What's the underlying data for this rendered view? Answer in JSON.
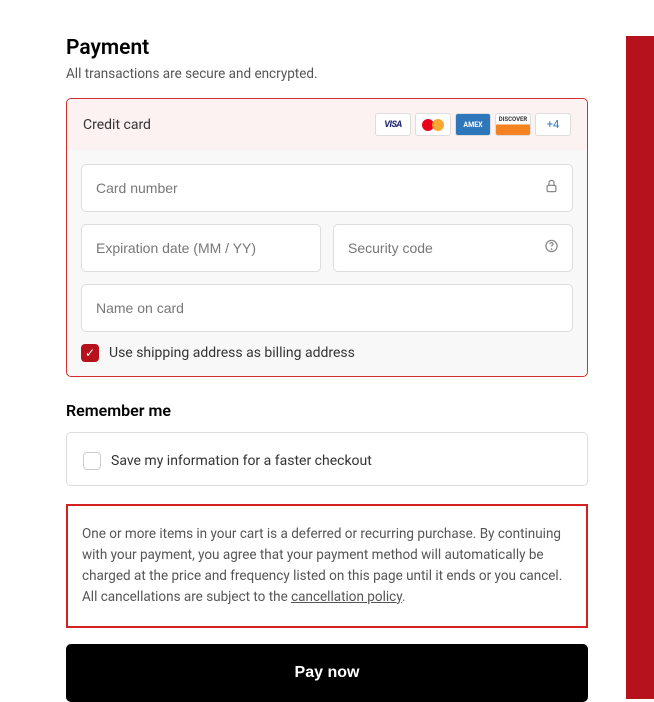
{
  "payment": {
    "title": "Payment",
    "subtitle": "All transactions are secure and encrypted.",
    "method_label": "Credit card",
    "cards": {
      "visa": "VISA",
      "amex": "AMEX",
      "discover": "DISCOVER",
      "more": "+4"
    },
    "fields": {
      "card_number_placeholder": "Card number",
      "expiry_placeholder": "Expiration date (MM / YY)",
      "cvv_placeholder": "Security code",
      "name_placeholder": "Name on card"
    },
    "use_shipping_label": "Use shipping address as billing address",
    "use_shipping_checked": true
  },
  "remember": {
    "title": "Remember me",
    "save_label": "Save my information for a faster checkout",
    "save_checked": false
  },
  "disclaimer": {
    "text_1": "One or more items in your cart is a deferred or recurring purchase. By continuing with your payment, you agree that your payment method will automatically be charged at the price and frequency listed on this page until it ends or you cancel. All cancellations are subject to the ",
    "link_text": "cancellation policy",
    "text_2": "."
  },
  "pay_button": "Pay now"
}
